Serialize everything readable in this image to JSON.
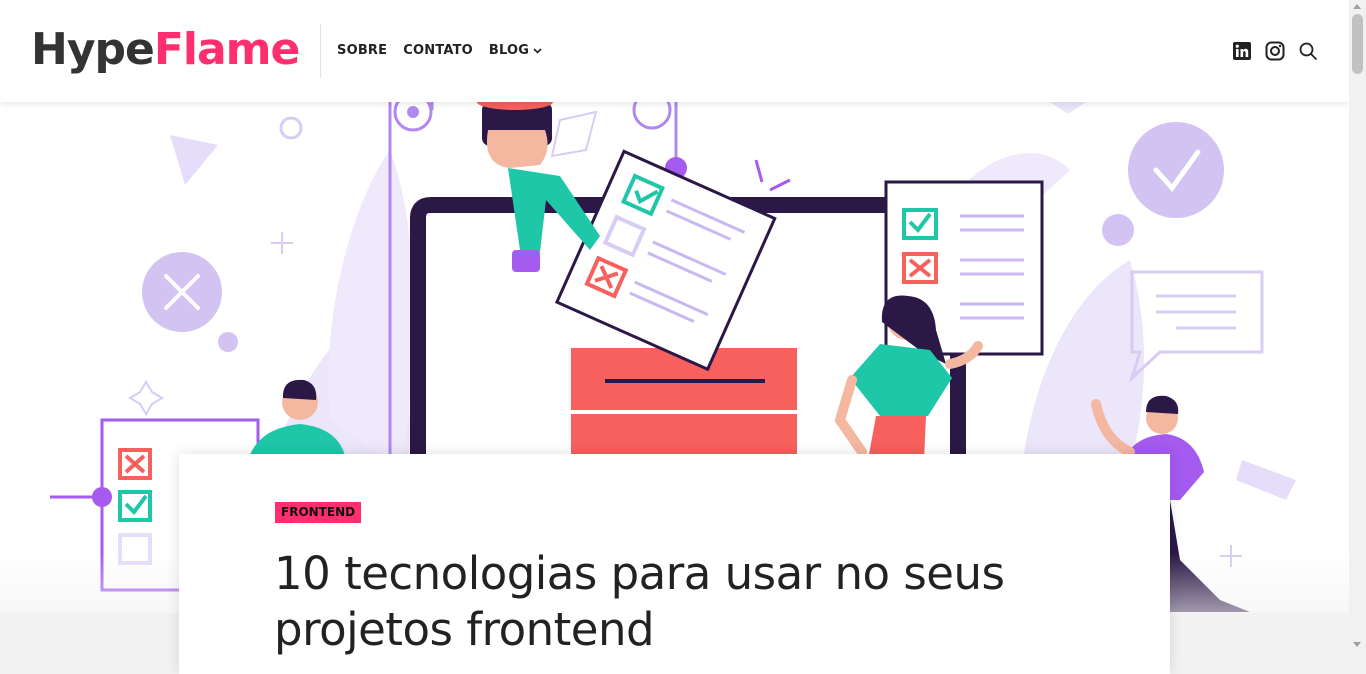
{
  "brand": {
    "part1": "Hype",
    "part2": "Flame",
    "color_dark": "#333333",
    "color_accent": "#ff2e6e"
  },
  "nav": {
    "items": [
      {
        "label": "SOBRE"
      },
      {
        "label": "CONTATO"
      },
      {
        "label": "BLOG",
        "has_dropdown": true
      }
    ]
  },
  "header_icons": [
    "linkedin-icon",
    "instagram-icon",
    "search-icon"
  ],
  "hero": {
    "illustration": "people-checklist-illustration",
    "palette": [
      "#c9b8f2",
      "#2b1847",
      "#1fc7a9",
      "#f7605c",
      "#a55af0"
    ]
  },
  "post": {
    "category": "FRONTEND",
    "title": "10 tecnologias para usar no seus projetos frontend"
  }
}
